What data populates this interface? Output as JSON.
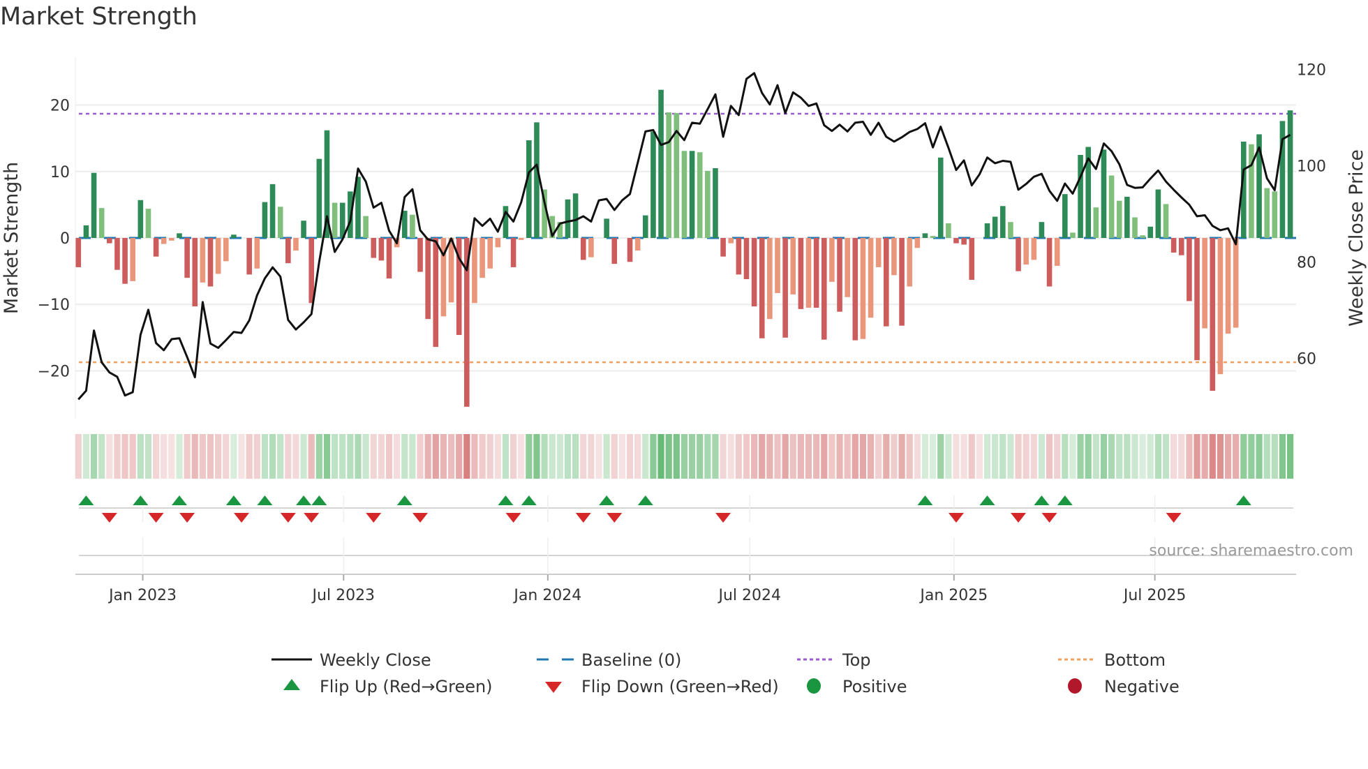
{
  "title": "Market Strength",
  "source": "source: sharemaestro.com",
  "chart_data": {
    "type": "bar",
    "title": "Market Strength",
    "ylabel": "Market Strength",
    "y2label": "Weekly Close Price",
    "ylim": [
      -27.2,
      27.2
    ],
    "y2lim": [
      47.5,
      122.5
    ],
    "yticks": [
      20,
      10,
      0,
      -10,
      -20
    ],
    "yticklabels": [
      "20",
      "10",
      "0",
      "−10",
      "−20"
    ],
    "y2ticks": [
      120,
      100,
      80,
      60
    ],
    "y2ticklabels": [
      "120",
      "100",
      "80",
      "60"
    ],
    "top": 18.7,
    "bottom": -18.7,
    "baseline": 0,
    "start_week": "2022-11-04",
    "frequency": "weekly",
    "xticks": [
      {
        "date": "2023-01-01",
        "label": "Jan 2023"
      },
      {
        "date": "2023-07-01",
        "label": "Jul 2023"
      },
      {
        "date": "2024-01-01",
        "label": "Jan 2024"
      },
      {
        "date": "2024-07-01",
        "label": "Jul 2024"
      },
      {
        "date": "2025-01-01",
        "label": "Jan 2025"
      },
      {
        "date": "2025-07-01",
        "label": "Jul 2025"
      }
    ],
    "strength": [
      -4.4,
      1.9,
      9.8,
      4.5,
      -0.8,
      -4.8,
      -6.9,
      -6.5,
      5.7,
      4.4,
      -2.8,
      -0.9,
      -0.4,
      0.7,
      -6.0,
      -10.3,
      -6.7,
      -7.3,
      -5.4,
      -3.5,
      0.5,
      0,
      -5.5,
      -4.6,
      5.4,
      8.1,
      4.7,
      -3.8,
      -1.9,
      2.6,
      -9.8,
      11.9,
      16.2,
      5.3,
      5.3,
      7.0,
      9.2,
      3.3,
      -3.0,
      -3.4,
      -6.1,
      -1.4,
      4.1,
      3.5,
      -5.1,
      -12.2,
      -16.4,
      -11.8,
      -9.7,
      -14.6,
      -25.4,
      -9.8,
      -6.0,
      -4.6,
      -1.4,
      4.8,
      -4.4,
      -0.3,
      14.7,
      17.4,
      7.3,
      3.3,
      2.4,
      5.8,
      6.7,
      -3.3,
      -2.9,
      0,
      2.9,
      -3.9,
      0,
      -3.6,
      -1.9,
      3.4,
      16.0,
      22.3,
      18.9,
      18.8,
      13.1,
      13.1,
      12.9,
      10.1,
      10.5,
      -2.8,
      -0.8,
      -5.5,
      -6.2,
      -10.3,
      -15.1,
      -12.2,
      -8.3,
      -15.0,
      -8.5,
      -10.7,
      -10.5,
      -10.5,
      -15.3,
      -6.6,
      -11.1,
      -8.9,
      -15.4,
      -15.2,
      -12.0,
      -4.4,
      -13.3,
      -5.6,
      -13.2,
      -7.3,
      -1.5,
      0.7,
      0.3,
      12.1,
      2.2,
      -0.8,
      -1.0,
      -6.3,
      0,
      2.2,
      3.2,
      4.8,
      2.4,
      -5.0,
      -4.0,
      -3.3,
      2.4,
      -7.3,
      -4.2,
      6.6,
      0.8,
      12.5,
      13.7,
      4.6,
      13.3,
      9.4,
      5.6,
      6.2,
      3.1,
      0.4,
      1.7,
      7.3,
      5.1,
      -2.2,
      -2.6,
      -9.5,
      -18.4,
      -13.6,
      -23.0,
      -20.5,
      -14.4,
      -13.5,
      14.5,
      14.1,
      15.6,
      7.5,
      7.0,
      17.6,
      19.2
    ],
    "weekly_close": [
      51.5,
      53.3,
      65.8,
      59.2,
      57.1,
      56.2,
      52.3,
      53.0,
      64.9,
      70.1,
      63.2,
      61.7,
      64.0,
      64.2,
      60.3,
      56.1,
      71.7,
      63.1,
      62.2,
      63.8,
      65.5,
      65.3,
      67.9,
      73.1,
      76.6,
      78.9,
      77.0,
      68.0,
      66.0,
      67.5,
      69.2,
      80.0,
      89.5,
      82.1,
      84.7,
      88.5,
      99.4,
      96.7,
      91.3,
      92.3,
      86.5,
      83.9,
      93.5,
      95.1,
      86.6,
      84.7,
      84.3,
      81.4,
      84.9,
      80.8,
      78.3,
      89.1,
      87.5,
      89.0,
      86.3,
      90.4,
      88.4,
      92.4,
      98.6,
      100.2,
      92.4,
      85.4,
      88.0,
      88.4,
      88.7,
      89.5,
      88.4,
      92.8,
      93.1,
      90.8,
      92.8,
      94.1,
      100.6,
      107.1,
      107.4,
      104.3,
      104.9,
      107.2,
      105.3,
      108.9,
      108.7,
      111.7,
      114.8,
      106.0,
      112.4,
      110.5,
      118.0,
      119.2,
      115.1,
      112.7,
      116.7,
      110.9,
      115.2,
      114.1,
      112.4,
      112.9,
      108.4,
      107.2,
      108.5,
      107.1,
      108.9,
      109.1,
      106.4,
      108.9,
      106.0,
      105.0,
      105.9,
      107.0,
      107.6,
      108.8,
      103.8,
      108.1,
      103.7,
      99.1,
      101.1,
      95.9,
      98.2,
      101.7,
      100.5,
      101.0,
      100.8,
      95.0,
      96.2,
      97.7,
      98.3,
      94.8,
      92.7,
      96.3,
      94.2,
      97.7,
      101.5,
      99.3,
      104.6,
      103.0,
      100.3,
      96.0,
      95.4,
      95.5,
      97.3,
      99.0,
      96.7,
      95.0,
      93.4,
      91.9,
      89.5,
      89.7,
      87.5,
      86.6,
      87.0,
      83.7,
      99.2,
      100.1,
      103.8,
      97.4,
      94.9,
      105.5,
      106.4
    ],
    "legend": [
      {
        "label": "Weekly Close",
        "symbol": "line"
      },
      {
        "label": "Baseline (0)",
        "symbol": "dash"
      },
      {
        "label": "Top",
        "symbol": "dot-purple"
      },
      {
        "label": "Bottom",
        "symbol": "dot-orange"
      },
      {
        "label": "Flip Up (Red→Green)",
        "symbol": "triangle-up"
      },
      {
        "label": "Flip Down (Green→Red)",
        "symbol": "triangle-down"
      },
      {
        "label": "Positive",
        "symbol": "circle-green"
      },
      {
        "label": "Negative",
        "symbol": "circle-red"
      }
    ],
    "legend_position": "bottom-center"
  },
  "colors": {
    "pos_strong": "#2e8b57",
    "pos_weak": "#7fbf7b",
    "neg_strong": "#cd5c5c",
    "neg_weak": "#e9967a",
    "band_pos": "46,160,67",
    "band_neg": "205,92,92",
    "top": "#9b59d6",
    "bottom": "#f0a05a",
    "baseline": "#1f77b4",
    "flip_up": "#1a9641",
    "flip_down": "#d62728",
    "positive": "#1a9641",
    "negative": "#b2182b",
    "close": "#111111"
  }
}
